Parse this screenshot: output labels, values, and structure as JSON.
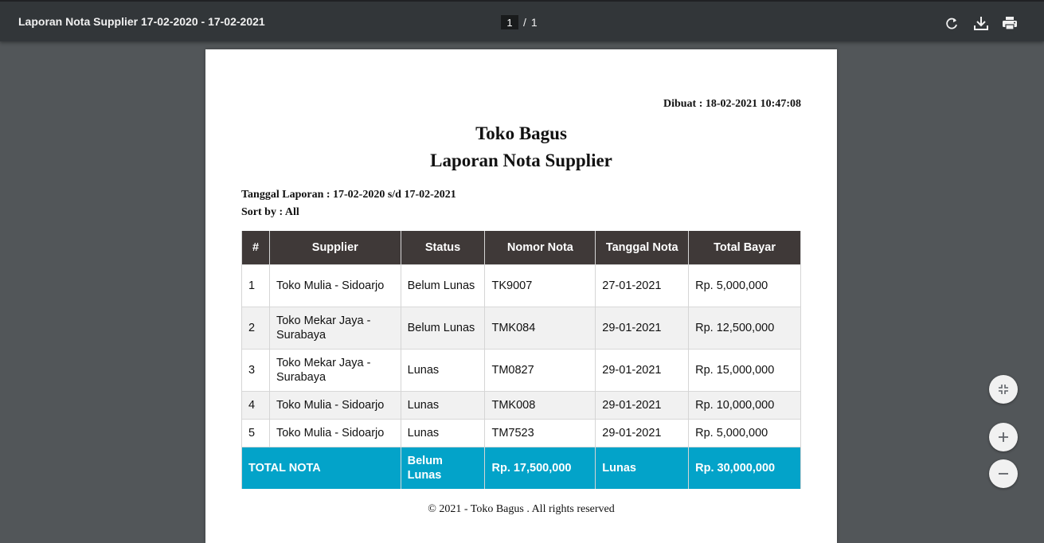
{
  "toolbar": {
    "title": "Laporan Nota Supplier 17-02-2020 - 17-02-2021",
    "current_page": "1",
    "page_separator": "/",
    "total_pages": "1"
  },
  "report": {
    "created": "Dibuat : 18-02-2021 10:47:08",
    "store_name": "Toko Bagus",
    "report_title": "Laporan Nota Supplier",
    "date_range": "Tanggal Laporan : 17-02-2020 s/d 17-02-2021",
    "sort": "Sort by : All",
    "columns": [
      "#",
      "Supplier",
      "Status",
      "Nomor Nota",
      "Tanggal Nota",
      "Total Bayar"
    ],
    "rows": [
      {
        "no": "1",
        "supplier": "Toko Mulia - Sidoarjo",
        "status": "Belum Lunas",
        "nomor": "TK9007",
        "tanggal": "27-01-2021",
        "total": "Rp. 5,000,000"
      },
      {
        "no": "2",
        "supplier": "Toko Mekar Jaya - Surabaya",
        "status": "Belum Lunas",
        "nomor": "TMK084",
        "tanggal": "29-01-2021",
        "total": "Rp. 12,500,000"
      },
      {
        "no": "3",
        "supplier": "Toko Mekar Jaya - Surabaya",
        "status": "Lunas",
        "nomor": "TM0827",
        "tanggal": "29-01-2021",
        "total": "Rp. 15,000,000"
      },
      {
        "no": "4",
        "supplier": "Toko Mulia - Sidoarjo",
        "status": "Lunas",
        "nomor": "TMK008",
        "tanggal": "29-01-2021",
        "total": "Rp. 10,000,000"
      },
      {
        "no": "5",
        "supplier": "Toko Mulia - Sidoarjo",
        "status": "Lunas",
        "nomor": "TM7523",
        "tanggal": "29-01-2021",
        "total": "Rp. 5,000,000"
      }
    ],
    "total_row": {
      "label": "TOTAL NOTA",
      "status": "Belum Lunas",
      "amount_unpaid": "Rp. 17,500,000",
      "status_paid": "Lunas",
      "amount_paid": "Rp. 30,000,000"
    },
    "footer": "© 2021 - Toko Bagus . All rights reserved"
  },
  "colors": {
    "toolbar": "#323639",
    "viewer_bg": "#525659",
    "table_header": "#3f3938",
    "total_row": "#03a3c9"
  },
  "icons": [
    "rotate-icon",
    "download-icon",
    "print-icon",
    "fit-page-icon",
    "zoom-in-icon",
    "zoom-out-icon"
  ]
}
